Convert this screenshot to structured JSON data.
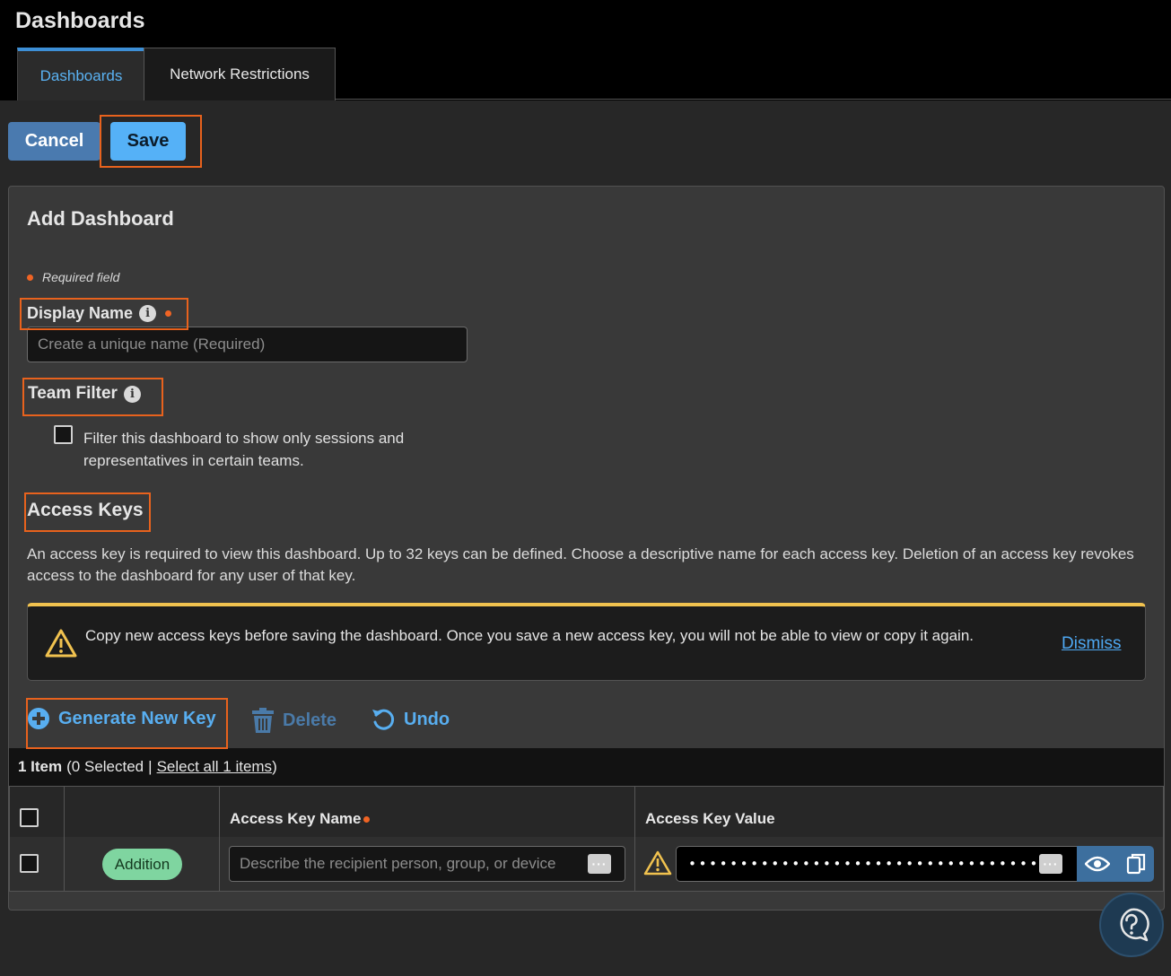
{
  "app": {
    "title": "Dashboards"
  },
  "tabs": [
    {
      "label": "Dashboards",
      "active": true
    },
    {
      "label": "Network Restrictions",
      "active": false
    }
  ],
  "toolbar": {
    "cancel_label": "Cancel",
    "save_label": "Save"
  },
  "form": {
    "title": "Add Dashboard",
    "required_note": "Required field",
    "display_name": {
      "label": "Display Name",
      "placeholder": "Create a unique name (Required)",
      "value": ""
    },
    "team_filter": {
      "label": "Team Filter",
      "checkbox_label": "Filter this dashboard to show only sessions and representatives in certain teams.",
      "checked": false
    }
  },
  "access_keys": {
    "heading": "Access Keys",
    "description": "An access key is required to view this dashboard. Up to 32 keys can be defined. Choose a descriptive name for each access key. Deletion of an access key revokes access to the dashboard for any user of that key.",
    "warning": {
      "text": "Copy new access keys before saving the dashboard. Once you save a new access key, you will not be able to view or copy it again.",
      "dismiss_label": "Dismiss"
    },
    "actions": {
      "generate_label": "Generate New Key",
      "delete_label": "Delete",
      "undo_label": "Undo"
    },
    "selection": {
      "count": "1 Item",
      "selected": "(0 Selected",
      "separator": "|",
      "select_all": "Select all 1 items",
      "close_paren": ")"
    },
    "table": {
      "columns": [
        "",
        "",
        "Access Key Name",
        "Access Key Value"
      ],
      "rows": [
        {
          "checked": false,
          "status": "Addition",
          "name_placeholder": "Describe the recipient person, group, or device",
          "name_value": "",
          "key_masked": "•••••••••••••••••••••••••••••••••••"
        }
      ]
    }
  },
  "colors": {
    "accent": "#55b1f7",
    "highlight": "#e8621d",
    "warning": "#f1c24f",
    "required": "#f06424",
    "status_addition": "#7fd5a0"
  },
  "help": {
    "icon": "question-bubble-icon"
  }
}
